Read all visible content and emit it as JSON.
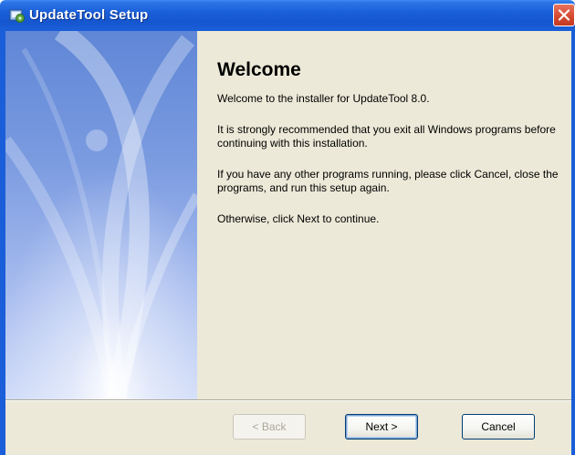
{
  "window": {
    "title": "UpdateTool Setup",
    "title_icon": "setup-icon",
    "close_icon": "close-icon"
  },
  "welcome": {
    "heading": "Welcome",
    "paragraphs": [
      "Welcome to the installer for UpdateTool 8.0.",
      "It is strongly recommended that you exit all Windows programs before continuing with this installation.",
      "If you have any other programs running, please click Cancel, close the programs, and run this setup again.",
      "Otherwise, click Next to continue."
    ]
  },
  "buttons": {
    "back": {
      "label": "< Back",
      "enabled": false
    },
    "next": {
      "label": "Next >",
      "enabled": true,
      "default": true
    },
    "cancel": {
      "label": "Cancel",
      "enabled": true
    }
  },
  "colors": {
    "titlebar": "#1a5fd9",
    "close_button": "#d3482f",
    "dialog_background": "#ece9d8",
    "banner": "#7b9be0"
  }
}
